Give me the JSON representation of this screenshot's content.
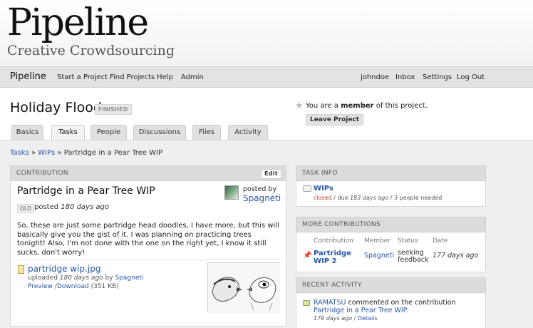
{
  "site": {
    "logo": "Pipeline",
    "tagline": "Creative Crowdsourcing"
  },
  "nav": {
    "brand": "Pipeline",
    "left_items": [
      "Start a Project",
      "Find Projects",
      "Help",
      "Admin"
    ],
    "right_items": [
      "johndoe",
      "Inbox",
      "Settings",
      "Log Out"
    ]
  },
  "project": {
    "title": "Holiday Flood",
    "status": "FINISHED",
    "membership_prefix": "You are a",
    "membership_role": "member",
    "membership_suffix": "of this project.",
    "leave_label": "Leave Project"
  },
  "tabs": [
    {
      "label": "Basics",
      "active": false
    },
    {
      "label": "Tasks",
      "active": true
    },
    {
      "label": "People",
      "active": false
    },
    {
      "label": "Discussions",
      "active": false
    },
    {
      "label": "Files",
      "active": false
    },
    {
      "label": "Activity",
      "active": false
    }
  ],
  "breadcrumb": {
    "items": [
      "Tasks",
      "WIPs"
    ],
    "separator": "»",
    "current": "Partridge in a Pear Tree WIP"
  },
  "contribution": {
    "panel_title": "CONTRIBUTION",
    "edit_label": "Edit",
    "title": "Partridge in a Pear Tree WIP",
    "badge": "OLD",
    "posted_prefix": "posted",
    "posted_when": "180 days ago",
    "posted_by_label": "posted by",
    "author": "Spagneti",
    "description": "So, these are just some partridge head doodles, I have more, but this will basically give you the gist of it. I was planning on practicing trees tonight! Also, I'm not done with the one on the right yet, I know it still sucks, don't worry!",
    "file": {
      "name": "partridge wip.jpg",
      "uploaded_prefix": "uploaded",
      "uploaded_when": "180 days ago",
      "uploaded_by": "by",
      "uploader": "Spagneti",
      "preview_label": "Preview",
      "download_label": "Download",
      "size": "(351 KB)"
    }
  },
  "task_info": {
    "panel_title": "TASK INFO",
    "task_name": "WIPs",
    "state": "closed",
    "due_prefix": "due",
    "due_when": "183 days ago",
    "needed": "3 people needed"
  },
  "more_contributions": {
    "panel_title": "MORE CONTRIBUTIONS",
    "columns": [
      "Contribution",
      "Member",
      "Status",
      "Date"
    ],
    "rows": [
      {
        "title": "Partridge WIP 2",
        "member": "Spagneti",
        "status": "seeking feedback",
        "date": "177 days ago"
      }
    ]
  },
  "recent_activity": {
    "panel_title": "RECENT ACTIVITY",
    "actor": "RAMATSU",
    "action": "commented on the contribution",
    "target": "Partridge in a Pear Tree WIP.",
    "when": "179 days ago",
    "details_label": "Details"
  },
  "colors": {
    "link": "#2a57a6",
    "closed": "#c0392b",
    "content_bg": "#efefef"
  }
}
